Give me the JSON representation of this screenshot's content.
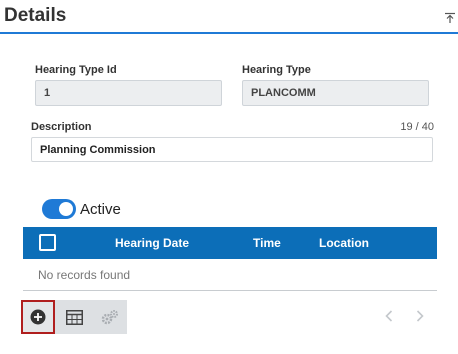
{
  "panel": {
    "title": "Details"
  },
  "fields": {
    "hearing_type_id": {
      "label": "Hearing Type Id",
      "value": "1"
    },
    "hearing_type": {
      "label": "Hearing Type",
      "value": "PLANCOMM"
    },
    "description": {
      "label": "Description",
      "value": "Planning Commission",
      "char_count": "19 / 40"
    }
  },
  "active_toggle": {
    "label": "Active",
    "on": true
  },
  "grid": {
    "columns": [
      "Hearing Date",
      "Time",
      "Location"
    ],
    "empty_message": "No records found"
  },
  "toolbar": {
    "icons": [
      "add-icon",
      "table-icon",
      "gears-icon"
    ]
  },
  "pager": {
    "icons": [
      "chevron-left-icon",
      "chevron-right-icon"
    ]
  },
  "colors": {
    "accent": "#1f7ad6",
    "grid_header": "#0c6eb8",
    "selected_border": "#b01e1e"
  }
}
